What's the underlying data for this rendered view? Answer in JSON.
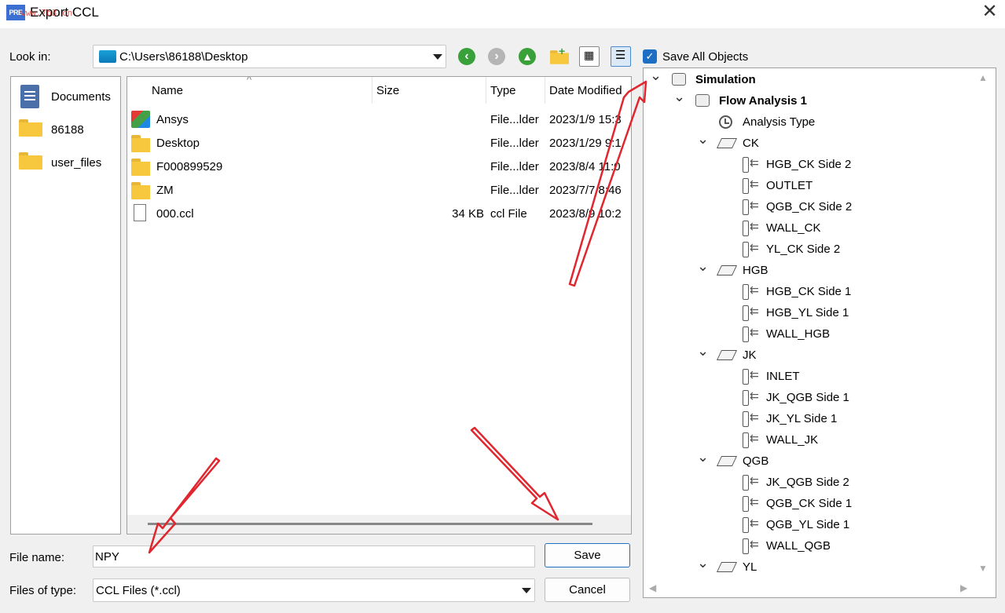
{
  "window": {
    "title": "Export CCL",
    "app_icon": "PRE",
    "watermark": "www.7b3.cn"
  },
  "look_in": {
    "label": "Look in:",
    "path": "C:\\Users\\86188\\Desktop"
  },
  "toolbar": {
    "icons": [
      "back-icon",
      "forward-icon",
      "up-icon",
      "new-folder-icon",
      "icon-view-icon",
      "detail-view-icon"
    ]
  },
  "save_all": {
    "label": "Save All Objects",
    "checked": true
  },
  "places": [
    {
      "label": "Documents",
      "icon": "documents-icon"
    },
    {
      "label": "86188",
      "icon": "folder-icon"
    },
    {
      "label": "user_files",
      "icon": "folder-icon"
    }
  ],
  "file_list": {
    "columns": [
      "Name",
      "Size",
      "Type",
      "Date Modified"
    ],
    "rows": [
      {
        "name": "Ansys",
        "size": "",
        "type": "File...lder",
        "date": "2023/1/9 15:3",
        "icon": "ansys-folder-icon"
      },
      {
        "name": "Desktop",
        "size": "",
        "type": "File...lder",
        "date": "2023/1/29 9:1",
        "icon": "folder-icon"
      },
      {
        "name": "F000899529",
        "size": "",
        "type": "File...lder",
        "date": "2023/8/4 11:0",
        "icon": "folder-icon"
      },
      {
        "name": "ZM",
        "size": "",
        "type": "File...lder",
        "date": "2023/7/7 8:46",
        "icon": "folder-icon"
      },
      {
        "name": "000.ccl",
        "size": "34 KB",
        "type": "ccl File",
        "date": "2023/8/9 10:2",
        "icon": "file-icon"
      }
    ]
  },
  "tree": {
    "nodes": [
      {
        "label": "Simulation",
        "level": 0,
        "bold": true,
        "icon": "cube",
        "chev": true
      },
      {
        "label": "Flow Analysis 1",
        "level": 1,
        "bold": true,
        "icon": "cube",
        "chev": true
      },
      {
        "label": "Analysis Type",
        "level": 2,
        "icon": "clock"
      },
      {
        "label": "CK",
        "level": 2,
        "icon": "box",
        "chev": true
      },
      {
        "label": "HGB_CK Side 2",
        "level": 3,
        "icon": "boundary"
      },
      {
        "label": "OUTLET",
        "level": 3,
        "icon": "boundary"
      },
      {
        "label": "QGB_CK Side 2",
        "level": 3,
        "icon": "boundary"
      },
      {
        "label": "WALL_CK",
        "level": 3,
        "icon": "boundary"
      },
      {
        "label": "YL_CK Side 2",
        "level": 3,
        "icon": "boundary"
      },
      {
        "label": "HGB",
        "level": 2,
        "icon": "box",
        "chev": true
      },
      {
        "label": "HGB_CK Side 1",
        "level": 3,
        "icon": "boundary"
      },
      {
        "label": "HGB_YL Side 1",
        "level": 3,
        "icon": "boundary"
      },
      {
        "label": "WALL_HGB",
        "level": 3,
        "icon": "boundary"
      },
      {
        "label": "JK",
        "level": 2,
        "icon": "box",
        "chev": true
      },
      {
        "label": "INLET",
        "level": 3,
        "icon": "boundary"
      },
      {
        "label": "JK_QGB Side 1",
        "level": 3,
        "icon": "boundary"
      },
      {
        "label": "JK_YL Side 1",
        "level": 3,
        "icon": "boundary"
      },
      {
        "label": "WALL_JK",
        "level": 3,
        "icon": "boundary"
      },
      {
        "label": "QGB",
        "level": 2,
        "icon": "box",
        "chev": true
      },
      {
        "label": "JK_QGB Side 2",
        "level": 3,
        "icon": "boundary"
      },
      {
        "label": "QGB_CK Side 1",
        "level": 3,
        "icon": "boundary"
      },
      {
        "label": "QGB_YL Side 1",
        "level": 3,
        "icon": "boundary"
      },
      {
        "label": "WALL_QGB",
        "level": 3,
        "icon": "boundary"
      },
      {
        "label": "YL",
        "level": 2,
        "icon": "box",
        "chev": true
      }
    ]
  },
  "file_name": {
    "label": "File name:",
    "value": "NPY"
  },
  "file_type": {
    "label": "Files of type:",
    "value": "CCL Files (*.ccl)"
  },
  "buttons": {
    "save": "Save",
    "cancel": "Cancel"
  },
  "colors": {
    "accent": "#1e6fc4",
    "annotation_arrow": "#e0262e"
  }
}
